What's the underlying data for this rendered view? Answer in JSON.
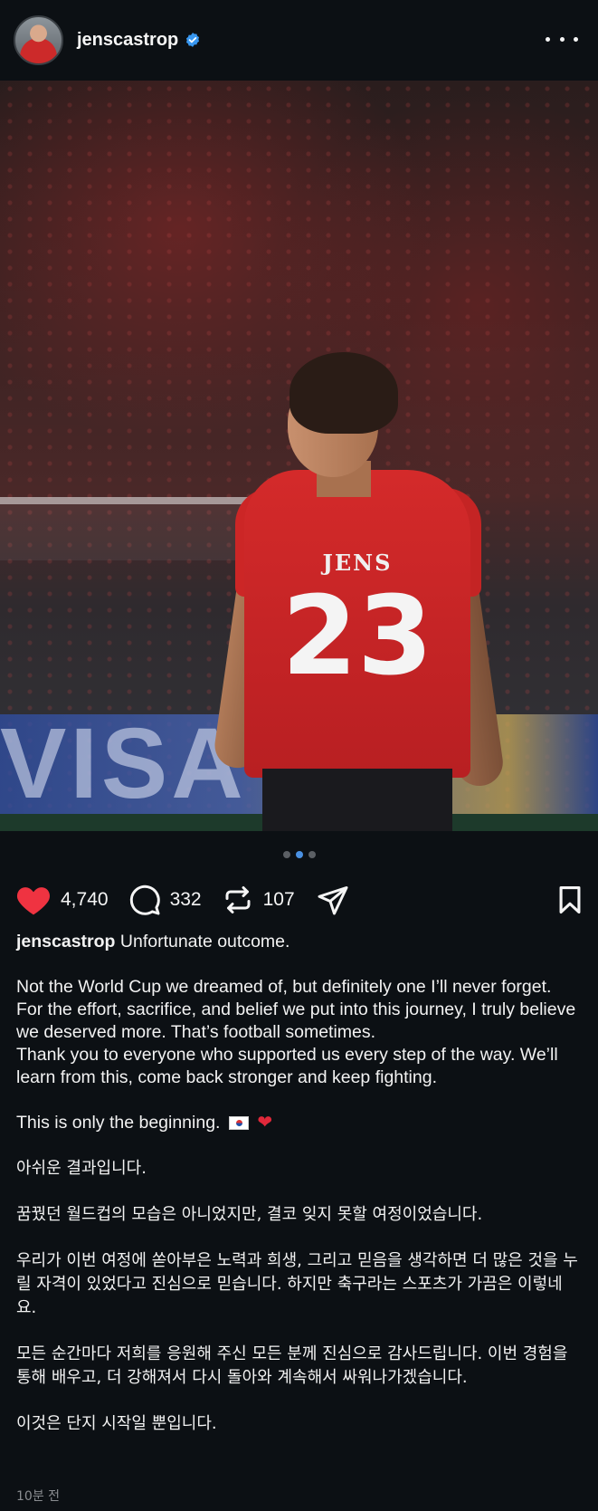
{
  "post": {
    "username": "jenscastrop",
    "jersey_name": "JENS",
    "jersey_number": "23",
    "board_text": "VISA",
    "carousel": {
      "count": 3,
      "active_index": 1
    },
    "likes": "4,740",
    "comments": "332",
    "reposts": "107",
    "caption": {
      "author": "jenscastrop",
      "line1": "Unfortunate outcome.",
      "para2": "Not the World Cup we dreamed of, but definitely one I’ll never forget.",
      "para3": "For the effort, sacrifice, and belief we put into this journey, I truly believe we deserved more. That’s football sometimes.",
      "para4": "Thank you to everyone who supported us every step of the way. We’ll learn from this, come back stronger and keep fighting.",
      "para5": "This is only the beginning.",
      "ko1": "아쉬운 결과입니다.",
      "ko2": "꿈꿨던 월드컵의 모습은 아니었지만, 결코 잊지 못할 여정이었습니다.",
      "ko3": "우리가 이번 여정에 쏟아부은 노력과 희생, 그리고 믿음을 생각하면 더 많은 것을 누릴 자격이 있었다고 진심으로 믿습니다. 하지만 축구라는 스포츠가 가끔은 이렇네요.",
      "ko4": "모든 순간마다 저희를 응원해 주신 모든 분께 진심으로 감사드립니다. 이번 경험을 통해 배우고, 더 강해져서 다시 돌아와 계속해서 싸워나가겠습니다.",
      "ko5": "이것은 단지 시작일 뿐입니다."
    },
    "timestamp": "10분 전"
  },
  "colors": {
    "background": "#0c1014",
    "like_red": "#ef3341",
    "verified_blue": "#3897f0",
    "carousel_active": "#4a90e2"
  },
  "icons": {
    "verified": "verified-badge-icon",
    "more": "more-options-icon",
    "like": "heart-filled-icon",
    "comment": "comment-bubble-icon",
    "repost": "repost-icon",
    "share": "send-paper-plane-icon",
    "bookmark": "bookmark-icon"
  }
}
